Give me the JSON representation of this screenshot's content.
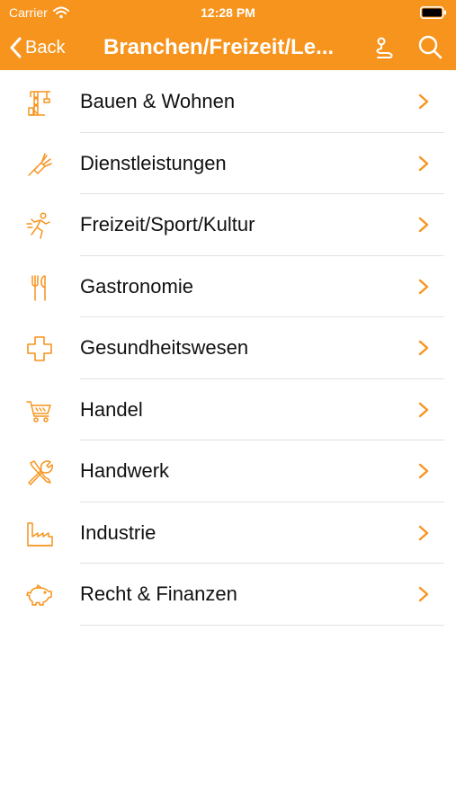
{
  "colors": {
    "accent": "#f7941d",
    "text": "#111111",
    "divider": "#e2e2e2",
    "white": "#ffffff"
  },
  "status_bar": {
    "carrier": "Carrier",
    "time": "12:28 PM"
  },
  "nav": {
    "back_label": "Back",
    "title": "Branchen/Freizeit/Le...",
    "right_icons": [
      "route-icon",
      "search-icon"
    ]
  },
  "categories": [
    {
      "label": "Bauen & Wohnen",
      "icon": "crane-icon"
    },
    {
      "label": "Dienstleistungen",
      "icon": "brush-icon"
    },
    {
      "label": "Freizeit/Sport/Kultur",
      "icon": "runner-icon"
    },
    {
      "label": "Gastronomie",
      "icon": "cutlery-icon"
    },
    {
      "label": "Gesundheitswesen",
      "icon": "cross-icon"
    },
    {
      "label": "Handel",
      "icon": "cart-icon"
    },
    {
      "label": "Handwerk",
      "icon": "tools-icon"
    },
    {
      "label": "Industrie",
      "icon": "factory-icon"
    },
    {
      "label": "Recht & Finanzen",
      "icon": "piggy-bank-icon"
    }
  ]
}
